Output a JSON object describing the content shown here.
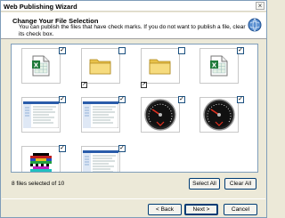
{
  "window": {
    "title": "Web Publishing Wizard"
  },
  "header": {
    "title": "Change Your File Selection",
    "description": "You can publish the files that have check marks.  If you do not want to publish a file, clear its check box."
  },
  "files": [
    {
      "kind": "excel-file-icon",
      "checked": true,
      "mark": "✓"
    },
    {
      "kind": "folder-icon",
      "checked": false,
      "mark": ""
    },
    {
      "kind": "folder-icon",
      "checked": false,
      "mark": ""
    },
    {
      "kind": "excel-file-icon",
      "checked": true,
      "mark": "✓"
    },
    {
      "kind": "webpage-thumbnail",
      "checked": true,
      "mark": "✓"
    },
    {
      "kind": "webpage-thumbnail",
      "checked": true,
      "mark": "✓"
    },
    {
      "kind": "speedometer-image",
      "checked": true,
      "mark": "✓"
    },
    {
      "kind": "speedometer-image",
      "checked": true,
      "mark": "✓"
    },
    {
      "kind": "pixel-art-image",
      "checked": true,
      "mark": "✓"
    },
    {
      "kind": "webpage-thumbnail",
      "checked": true,
      "mark": "✓"
    }
  ],
  "status": {
    "text": "8 files selected of 10"
  },
  "buttons": {
    "select_all": "Select All",
    "clear_all": "Clear All",
    "back": "< Back",
    "next": "Next >",
    "cancel": "Cancel"
  },
  "colors": {
    "window_bg": "#ece9d8",
    "border": "#7f9db9",
    "button_border": "#003c74",
    "excel_green": "#1f7a3a",
    "folder_yellow": "#f2d56b"
  }
}
